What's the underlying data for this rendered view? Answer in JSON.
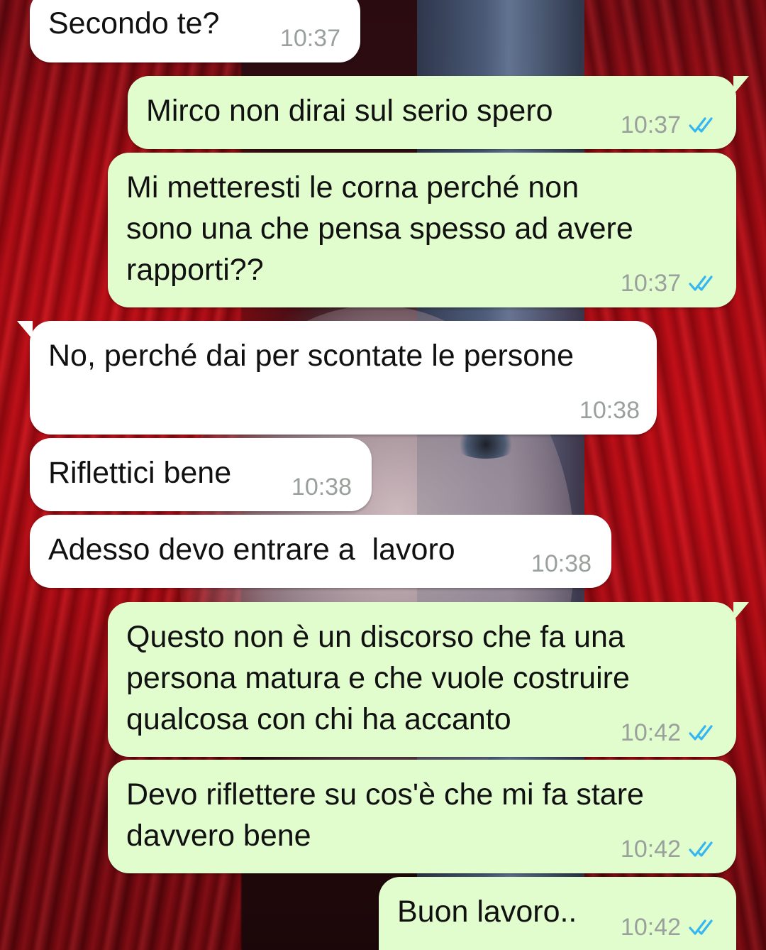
{
  "conversation": {
    "messages": [
      {
        "direction": "incoming",
        "text": "Secondo te?",
        "time": "10:37"
      },
      {
        "direction": "outgoing",
        "text": "Mirco non dirai sul serio spero",
        "time": "10:37",
        "read_receipt": "double-check-icon"
      },
      {
        "direction": "outgoing",
        "lines": [
          "Mi metteresti le corna perché non",
          "sono una che pensa spesso ad avere",
          "rapporti??"
        ],
        "time": "10:37",
        "read_receipt": "double-check-icon"
      },
      {
        "direction": "incoming",
        "text": "No, perché dai per scontate le persone",
        "time": "10:38"
      },
      {
        "direction": "incoming",
        "text": "Riflettici bene",
        "time": "10:38"
      },
      {
        "direction": "incoming",
        "text": "Adesso devo entrare a  lavoro",
        "time": "10:38"
      },
      {
        "direction": "outgoing",
        "lines": [
          "Questo non è un discorso che fa una",
          "persona matura e che vuole costruire",
          "qualcosa con chi ha accanto"
        ],
        "time": "10:42",
        "read_receipt": "double-check-icon"
      },
      {
        "direction": "outgoing",
        "lines": [
          "Devo riflettere su cos'è che mi fa stare",
          "davvero bene"
        ],
        "time": "10:42",
        "read_receipt": "double-check-icon"
      },
      {
        "direction": "outgoing",
        "text": "Buon lavoro..",
        "time": "10:42",
        "read_receipt": "double-check-icon"
      }
    ]
  },
  "colors": {
    "incoming_bubble": "#ffffff",
    "outgoing_bubble": "#e1fdce",
    "timestamp": "#9aa09c",
    "read_check": "#34b7f1"
  }
}
